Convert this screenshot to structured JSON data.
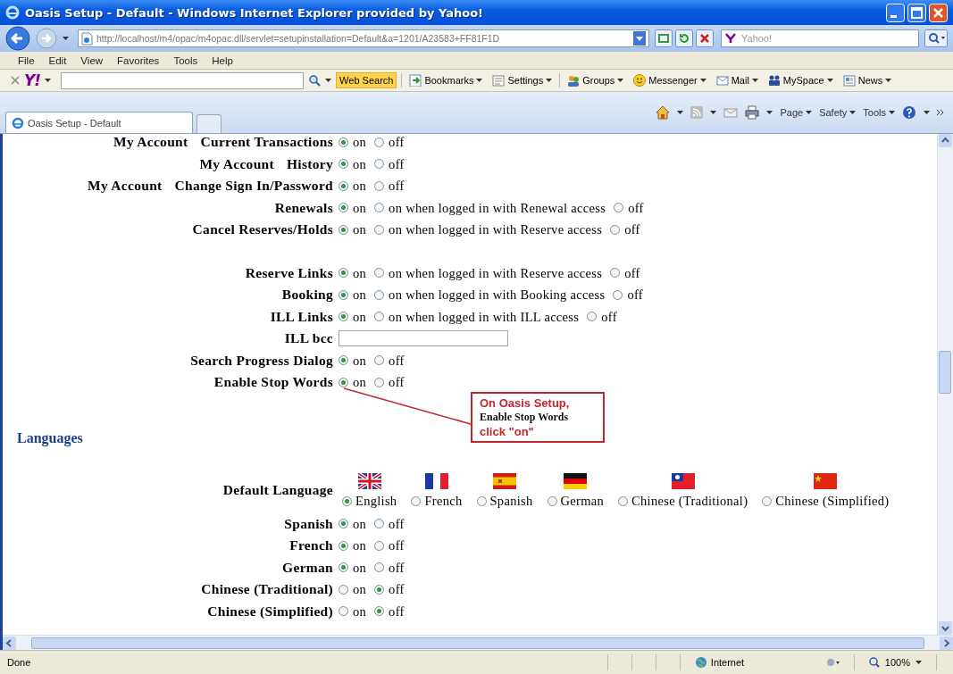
{
  "window": {
    "title": "Oasis Setup - Default - Windows Internet Explorer provided by Yahoo!"
  },
  "address_bar": {
    "url": "http://localhost/m4/opac/m4opac.dll/servlet=setupinstallation=Default&a=1201/A23583+FF81F1D",
    "search_value": "Yahoo!"
  },
  "menu": [
    "File",
    "Edit",
    "View",
    "Favorites",
    "Tools",
    "Help"
  ],
  "yahoo_toolbar": {
    "logo": "Y!",
    "search_button": "Web Search",
    "items": [
      {
        "kind": "bookmarks",
        "label": "Bookmarks"
      },
      {
        "kind": "settings",
        "label": "Settings"
      },
      {
        "kind": "groups",
        "label": "Groups"
      },
      {
        "kind": "messenger",
        "label": "Messenger"
      },
      {
        "kind": "mail",
        "label": "Mail"
      },
      {
        "kind": "myspace",
        "label": "MySpace"
      },
      {
        "kind": "news",
        "label": "News"
      }
    ]
  },
  "tabs": [
    {
      "label": "Oasis Setup - Default",
      "selected": true
    }
  ],
  "command_bar": [
    "Page",
    "Safety",
    "Tools"
  ],
  "setting_groups": [
    {
      "rows": [
        {
          "kind": "radio",
          "prefix": "My Account",
          "label": "Current Transactions",
          "options": [
            {
              "label": "on",
              "selected": true
            },
            {
              "label": "off",
              "selected": false
            }
          ]
        },
        {
          "kind": "radio",
          "prefix": "My Account",
          "label": "History",
          "options": [
            {
              "label": "on",
              "selected": true
            },
            {
              "label": "off",
              "selected": false
            }
          ]
        },
        {
          "kind": "radio",
          "prefix": "My Account",
          "label": "Change Sign In/Password",
          "options": [
            {
              "label": "on",
              "selected": true
            },
            {
              "label": "off",
              "selected": false
            }
          ]
        },
        {
          "kind": "radio",
          "label": "Renewals",
          "options": [
            {
              "label": "on",
              "selected": true
            },
            {
              "label": "on when logged in with Renewal access",
              "selected": false
            },
            {
              "label": "off",
              "selected": false
            }
          ]
        },
        {
          "kind": "radio",
          "label": "Cancel Reserves/Holds",
          "options": [
            {
              "label": "on",
              "selected": true
            },
            {
              "label": "on when logged in with Reserve access",
              "selected": false
            },
            {
              "label": "off",
              "selected": false
            }
          ]
        }
      ]
    },
    {
      "rows": [
        {
          "kind": "radio",
          "label": "Reserve Links",
          "options": [
            {
              "label": "on",
              "selected": true
            },
            {
              "label": "on when logged in with Reserve access",
              "selected": false
            },
            {
              "label": "off",
              "selected": false
            }
          ]
        },
        {
          "kind": "radio",
          "label": "Booking",
          "options": [
            {
              "label": "on",
              "selected": true
            },
            {
              "label": "on when logged in with Booking access",
              "selected": false
            },
            {
              "label": "off",
              "selected": false
            }
          ]
        },
        {
          "kind": "radio",
          "label": "ILL Links",
          "options": [
            {
              "label": "on",
              "selected": true
            },
            {
              "label": "on when logged in with ILL access",
              "selected": false
            },
            {
              "label": "off",
              "selected": false
            }
          ]
        },
        {
          "kind": "text",
          "label": "ILL bcc"
        },
        {
          "kind": "radio",
          "label": "Search Progress Dialog",
          "options": [
            {
              "label": "on",
              "selected": true
            },
            {
              "label": "off",
              "selected": false
            }
          ]
        },
        {
          "kind": "radio",
          "label": "Enable Stop Words",
          "options": [
            {
              "label": "on",
              "selected": true
            },
            {
              "label": "off",
              "selected": false
            }
          ]
        }
      ]
    }
  ],
  "languages": {
    "heading": "Languages",
    "default_language": {
      "label": "Default Language",
      "options": [
        {
          "kind": "uk",
          "label": "English",
          "selected": true
        },
        {
          "kind": "fr",
          "label": "French",
          "selected": false
        },
        {
          "kind": "es",
          "label": "Spanish",
          "selected": false
        },
        {
          "kind": "de",
          "label": "German",
          "selected": false
        },
        {
          "kind": "tw",
          "label": "Chinese (Traditional)",
          "selected": false
        },
        {
          "kind": "cn",
          "label": "Chinese (Simplified)",
          "selected": false
        }
      ]
    },
    "rows": [
      {
        "label": "Spanish",
        "options": [
          {
            "label": "on",
            "selected": true
          },
          {
            "label": "off",
            "selected": false
          }
        ]
      },
      {
        "label": "French",
        "options": [
          {
            "label": "on",
            "selected": true
          },
          {
            "label": "off",
            "selected": false
          }
        ]
      },
      {
        "label": "German",
        "options": [
          {
            "label": "on",
            "selected": true
          },
          {
            "label": "off",
            "selected": false
          }
        ]
      },
      {
        "label": "Chinese (Traditional)",
        "options": [
          {
            "label": "on",
            "selected": false
          },
          {
            "label": "off",
            "selected": true
          }
        ]
      },
      {
        "label": "Chinese (Simplified)",
        "options": [
          {
            "label": "on",
            "selected": false
          },
          {
            "label": "off",
            "selected": true
          }
        ]
      }
    ]
  },
  "callout": {
    "lines": [
      {
        "kind": "emphasis",
        "text": "On Oasis Setup,"
      },
      {
        "kind": "plain",
        "text": "Enable Stop Words"
      },
      {
        "kind": "emphasis",
        "text": "click \"on\""
      }
    ]
  },
  "status_bar": {
    "text": "Done",
    "zone": "Internet",
    "zoom": "100%"
  }
}
